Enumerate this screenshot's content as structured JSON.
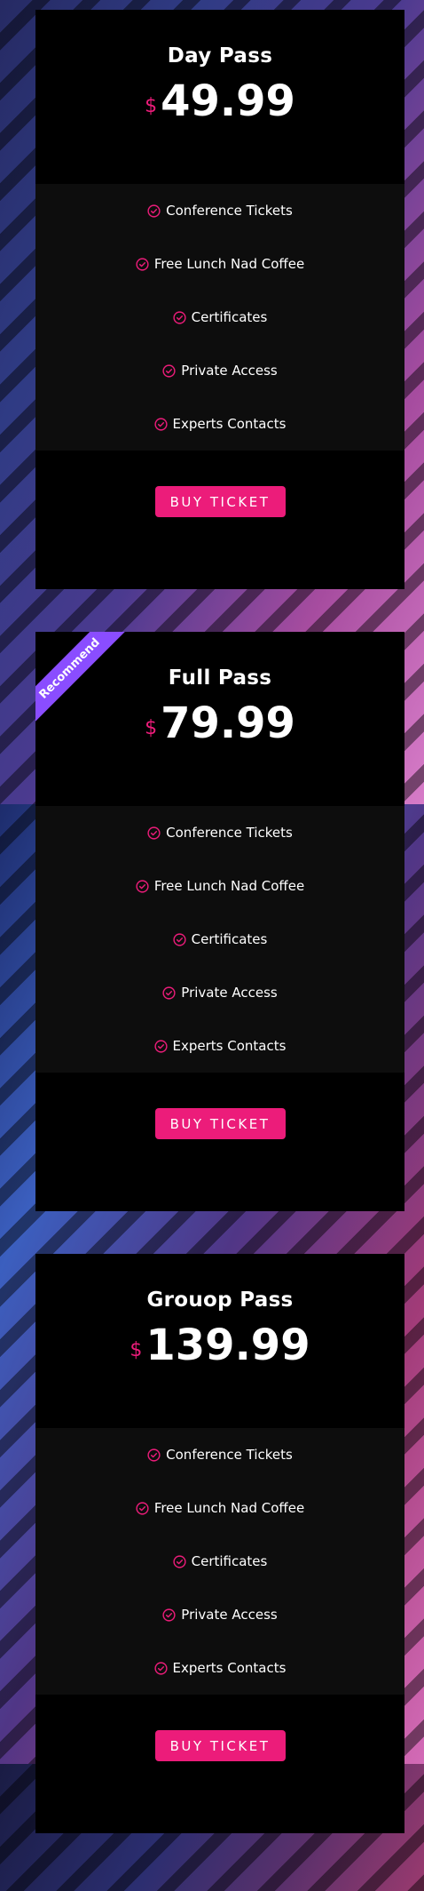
{
  "colors": {
    "accent": "#ec1c7a",
    "ribbon": "#8a4dff",
    "card_bg": "#000000",
    "features_bg": "#0d0d0d"
  },
  "cards": [
    {
      "name": "Day Pass",
      "currency": "$",
      "price": "49.99",
      "ribbon": "",
      "features": [
        "Conference Tickets",
        "Free Lunch Nad Coffee",
        "Certificates",
        "Private Access",
        "Experts Contacts"
      ],
      "button_label": "BUY TICKET"
    },
    {
      "name": "Full Pass",
      "currency": "$",
      "price": "79.99",
      "ribbon": "Recommend",
      "features": [
        "Conference Tickets",
        "Free Lunch Nad Coffee",
        "Certificates",
        "Private Access",
        "Experts Contacts"
      ],
      "button_label": "BUY TICKET"
    },
    {
      "name": "Grouop Pass",
      "currency": "$",
      "price": "139.99",
      "ribbon": "",
      "features": [
        "Conference Tickets",
        "Free Lunch Nad Coffee",
        "Certificates",
        "Private Access",
        "Experts Contacts"
      ],
      "button_label": "BUY TICKET"
    }
  ]
}
